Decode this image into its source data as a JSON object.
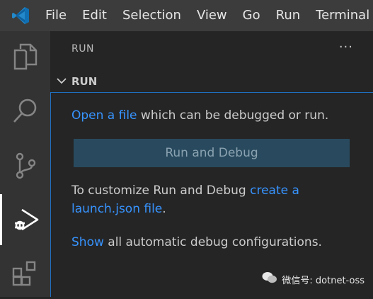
{
  "menu": [
    "File",
    "Edit",
    "Selection",
    "View",
    "Go",
    "Run",
    "Terminal"
  ],
  "activity_bar": [
    "explorer-icon",
    "search-icon",
    "source-control-icon",
    "run-debug-icon",
    "extensions-icon"
  ],
  "sidebar": {
    "view_title": "RUN",
    "more_actions": "···",
    "section_title": "RUN"
  },
  "welcome": {
    "open_file_link": "Open a file",
    "open_file_rest": " which can be debugged or run.",
    "run_button": "Run and Debug",
    "customize_prefix": "To customize Run and Debug ",
    "customize_link_1": "create a",
    "customize_link_2": "launch.json file",
    "customize_suffix": ".",
    "show_link": "Show",
    "show_rest": " all automatic debug configurations."
  },
  "watermark": "微信号: dotnet-oss",
  "colors": {
    "link": "#3794ff",
    "button": "#294a5e",
    "accent": "#1f6fc0"
  }
}
